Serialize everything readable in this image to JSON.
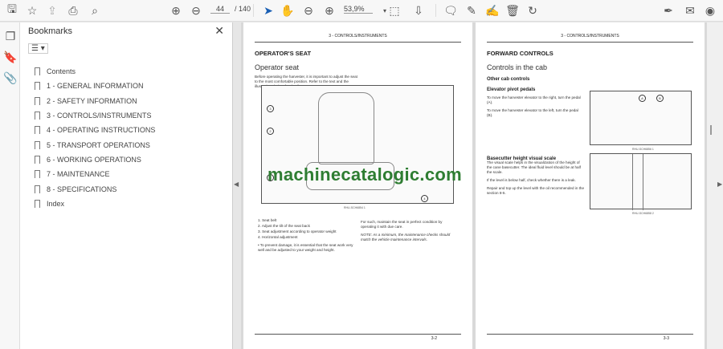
{
  "toolbar": {
    "page_current": "44",
    "page_total": "/ 140",
    "zoom": "53,9%"
  },
  "bookmarks": {
    "title": "Bookmarks",
    "items": [
      "Contents",
      "1 - GENERAL INFORMATION",
      "2 - SAFETY INFORMATION",
      "3 - CONTROLS/INSTRUMENTS",
      "4 - OPERATING INSTRUCTIONS",
      "5 - TRANSPORT OPERATIONS",
      "6 - WORKING OPERATIONS",
      "7 - MAINTENANCE",
      "8 - SPECIFICATIONS",
      "Index"
    ]
  },
  "page_left": {
    "header": "3 - CONTROLS/INSTRUMENTS",
    "title": "OPERATOR'S SEAT",
    "subtitle": "Operator seat",
    "intro": "Before operating the harvester, it is important to adjust the seat to the most comfortable position.  Refer to the text and the illustrations below for details.",
    "fig_caption": "RHU-SCH6854 1",
    "list": [
      "1.  Seat belt",
      "2.  Adjust the tilt of the seat back",
      "3.  Seat adjustment according to operator weight",
      "4.  Horizontal adjustment"
    ],
    "bullet": "•  To prevent damage, it is essential that the seat work very well and be adjusted to your weight and height.",
    "right_text": "For such, maintain the seat in perfect condition by operating it with due care.",
    "note": "NOTE:  As a minimum, the maintenance checks should match the vehicle maintenance intervals.",
    "footer": "3-2"
  },
  "page_right": {
    "header": "3 - CONTROLS/INSTRUMENTS",
    "title": "FORWARD CONTROLS",
    "subtitle": "Controls in the cab",
    "section": "Other cab controls",
    "sub1": "Elevator pivot pedals",
    "p1": "To move the harvester elevator to the right, turn the pedal (A).",
    "p2": "To move the harvester elevator to the left, turn the pedal (B).",
    "cap1": "RHU-SCH6856 1",
    "sub2": "Basecutter height visual scale",
    "p3": "The visual scale helps in the visualization of the height of the cane basecutter.  The ideal fluid level should be at half the scale.",
    "p4": "If the level is below half, check whether there is a leak.",
    "p5": "Repair and top up the level with the oil recommended in the section 8-5.",
    "cap2": "RHU-SCH6858 2",
    "footer": "3-3"
  },
  "watermark": "machinecatalogic.com"
}
